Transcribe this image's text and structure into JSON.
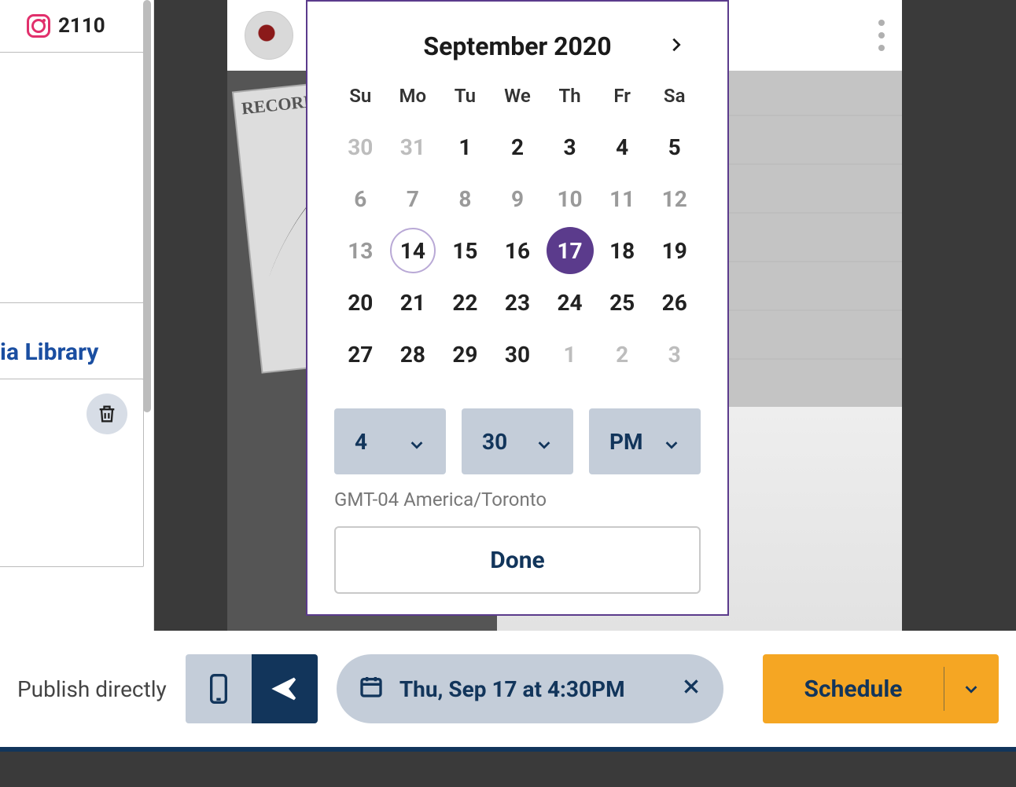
{
  "sidebar": {
    "account_handle": "2110",
    "library_label": "ia Library"
  },
  "post": {
    "menu_icon": "kebab"
  },
  "picker": {
    "month_label": "September 2020",
    "dow": [
      "Su",
      "Mo",
      "Tu",
      "We",
      "Th",
      "Fr",
      "Sa"
    ],
    "weeks": [
      [
        {
          "n": "30",
          "muted": true
        },
        {
          "n": "31",
          "muted": true
        },
        {
          "n": "1"
        },
        {
          "n": "2"
        },
        {
          "n": "3"
        },
        {
          "n": "4"
        },
        {
          "n": "5"
        }
      ],
      [
        {
          "n": "6",
          "past": true
        },
        {
          "n": "7",
          "past": true
        },
        {
          "n": "8",
          "past": true
        },
        {
          "n": "9",
          "past": true
        },
        {
          "n": "10",
          "past": true
        },
        {
          "n": "11",
          "past": true
        },
        {
          "n": "12",
          "past": true
        }
      ],
      [
        {
          "n": "13",
          "past": true
        },
        {
          "n": "14",
          "today": true
        },
        {
          "n": "15"
        },
        {
          "n": "16"
        },
        {
          "n": "17",
          "selected": true
        },
        {
          "n": "18"
        },
        {
          "n": "19"
        }
      ],
      [
        {
          "n": "20"
        },
        {
          "n": "21"
        },
        {
          "n": "22"
        },
        {
          "n": "23"
        },
        {
          "n": "24"
        },
        {
          "n": "25"
        },
        {
          "n": "26"
        }
      ],
      [
        {
          "n": "27"
        },
        {
          "n": "28"
        },
        {
          "n": "29"
        },
        {
          "n": "30"
        },
        {
          "n": "1",
          "muted": true
        },
        {
          "n": "2",
          "muted": true
        },
        {
          "n": "3",
          "muted": true
        }
      ]
    ],
    "hour": "4",
    "minute": "30",
    "ampm": "PM",
    "timezone": "GMT-04 America/Toronto",
    "done_label": "Done"
  },
  "bottom": {
    "publish_label": "Publish directly",
    "scheduled_text": "Thu, Sep 17 at 4:30PM",
    "schedule_button": "Schedule"
  }
}
